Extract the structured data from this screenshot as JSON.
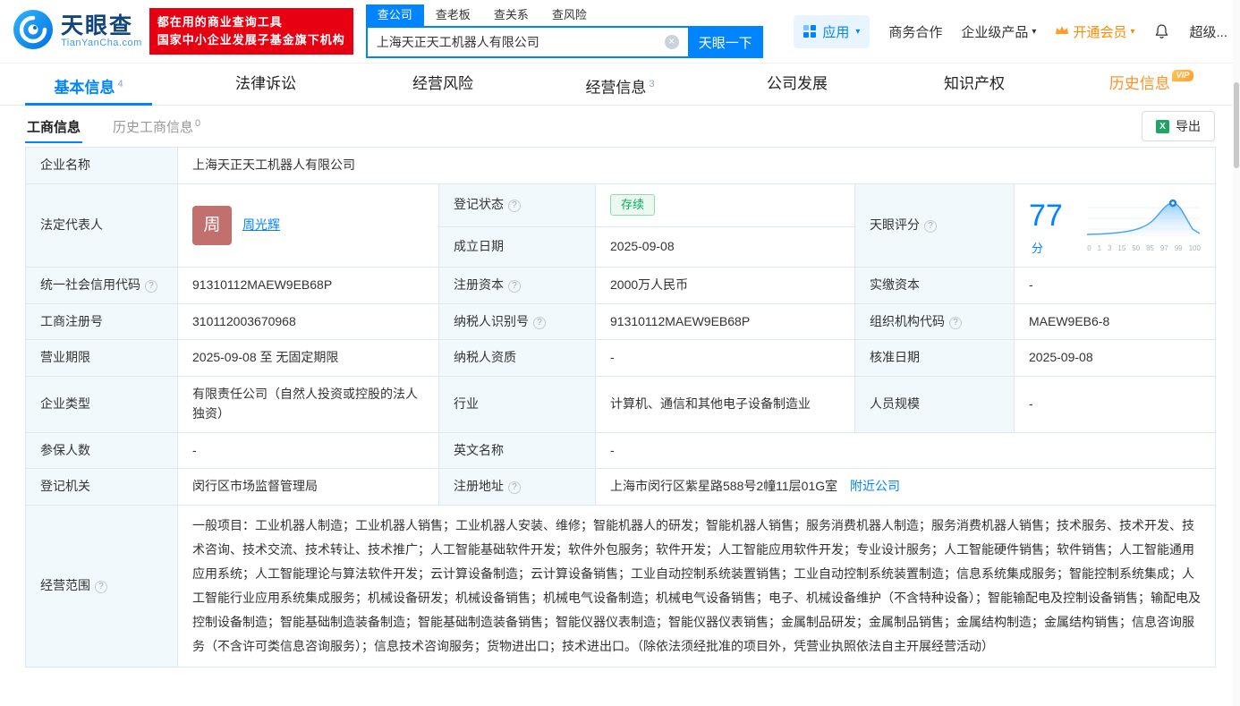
{
  "icons": {
    "question": "?",
    "chevron_down": "▾",
    "clear": "×",
    "excel": "X"
  },
  "colors": {
    "accent": "#0084ff",
    "slogan_red": "#e60012",
    "vip_orange": "#ff8a00",
    "status_green": "#00b25c"
  },
  "header": {
    "logo_brand": "天眼查",
    "logo_domain": "TianYanCha.com",
    "slogan_line1": "都在用的商业查询工具",
    "slogan_line2": "国家中小企业发展子基金旗下机构",
    "search_tabs": [
      {
        "label": "查公司"
      },
      {
        "label": "查老板"
      },
      {
        "label": "查关系"
      },
      {
        "label": "查风险"
      }
    ],
    "search_value": "上海天正天工机器人有限公司",
    "search_button": "天眼一下",
    "apps_label": "应用",
    "menu_business": "商务合作",
    "menu_enterprise": "企业级产品",
    "menu_vip": "开通会员",
    "menu_super": "超级..."
  },
  "nav_tabs": [
    {
      "label": "基本信息",
      "count": "4"
    },
    {
      "label": "法律诉讼"
    },
    {
      "label": "经营风险"
    },
    {
      "label": "经营信息",
      "count": "3"
    },
    {
      "label": "公司发展"
    },
    {
      "label": "知识产权"
    },
    {
      "label": "历史信息",
      "vip": "VIP"
    }
  ],
  "sub_tabs": {
    "active": "工商信息",
    "history": "历史工商信息",
    "history_count": "0"
  },
  "export_label": "导出",
  "table": {
    "company_name_label": "企业名称",
    "company_name": "上海天正天工机器人有限公司",
    "legal_rep_label": "法定代表人",
    "legal_rep_avatar": "周",
    "legal_rep_name": "周光辉",
    "reg_status_label": "登记状态",
    "reg_status_value": "存续",
    "establish_label": "成立日期",
    "establish_value": "2025-09-08",
    "score_label": "天眼评分",
    "score_value": "77",
    "score_unit": "分",
    "score_ticks": [
      "0",
      "1",
      "3",
      "15",
      "50",
      "85",
      "97",
      "99",
      "100"
    ],
    "credit_code_label": "统一社会信用代码",
    "credit_code": "91310112MAEW9EB68P",
    "reg_capital_label": "注册资本",
    "reg_capital": "2000万人民币",
    "paid_capital_label": "实缴资本",
    "paid_capital": "-",
    "reg_number_label": "工商注册号",
    "reg_number": "310112003670968",
    "taxpayer_id_label": "纳税人识别号",
    "taxpayer_id": "91310112MAEW9EB68P",
    "org_code_label": "组织机构代码",
    "org_code": "MAEW9EB6-8",
    "business_term_label": "营业期限",
    "business_term": "2025-09-08 至 无固定期限",
    "taxpayer_quality_label": "纳税人资质",
    "taxpayer_quality": "-",
    "approval_date_label": "核准日期",
    "approval_date": "2025-09-08",
    "company_type_label": "企业类型",
    "company_type": "有限责任公司（自然人投资或控股的法人独资）",
    "industry_label": "行业",
    "industry": "计算机、通信和其他电子设备制造业",
    "staff_size_label": "人员规模",
    "staff_size": "-",
    "insured_label": "参保人数",
    "insured": "-",
    "english_name_label": "英文名称",
    "english_name": "-",
    "reg_authority_label": "登记机关",
    "reg_authority": "闵行区市场监督管理局",
    "address_label": "注册地址",
    "address": "上海市闵行区紫星路588号2幢11层01G室",
    "address_link": "附近公司",
    "business_scope_label": "经营范围",
    "business_scope": "一般项目：工业机器人制造；工业机器人销售；工业机器人安装、维修；智能机器人的研发；智能机器人销售；服务消费机器人制造；服务消费机器人销售；技术服务、技术开发、技术咨询、技术交流、技术转让、技术推广；人工智能基础软件开发；软件外包服务；软件开发；人工智能应用软件开发；专业设计服务；人工智能硬件销售；软件销售；人工智能通用应用系统；人工智能理论与算法软件开发；云计算设备制造；云计算设备销售；工业自动控制系统装置销售；工业自动控制系统装置制造；信息系统集成服务；智能控制系统集成；人工智能行业应用系统集成服务；机械设备研发；机械设备销售；机械电气设备制造；机械电气设备销售；电子、机械设备维护（不含特种设备）；智能输配电及控制设备销售；输配电及控制设备制造；智能基础制造装备制造；智能基础制造装备销售；智能仪器仪表制造；智能仪器仪表销售；金属制品研发；金属制品销售；金属结构制造；金属结构销售；信息咨询服务（不含许可类信息咨询服务）；信息技术咨询服务；货物进出口；技术进出口。（除依法须经批准的项目外，凭营业执照依法自主开展经营活动）"
  }
}
